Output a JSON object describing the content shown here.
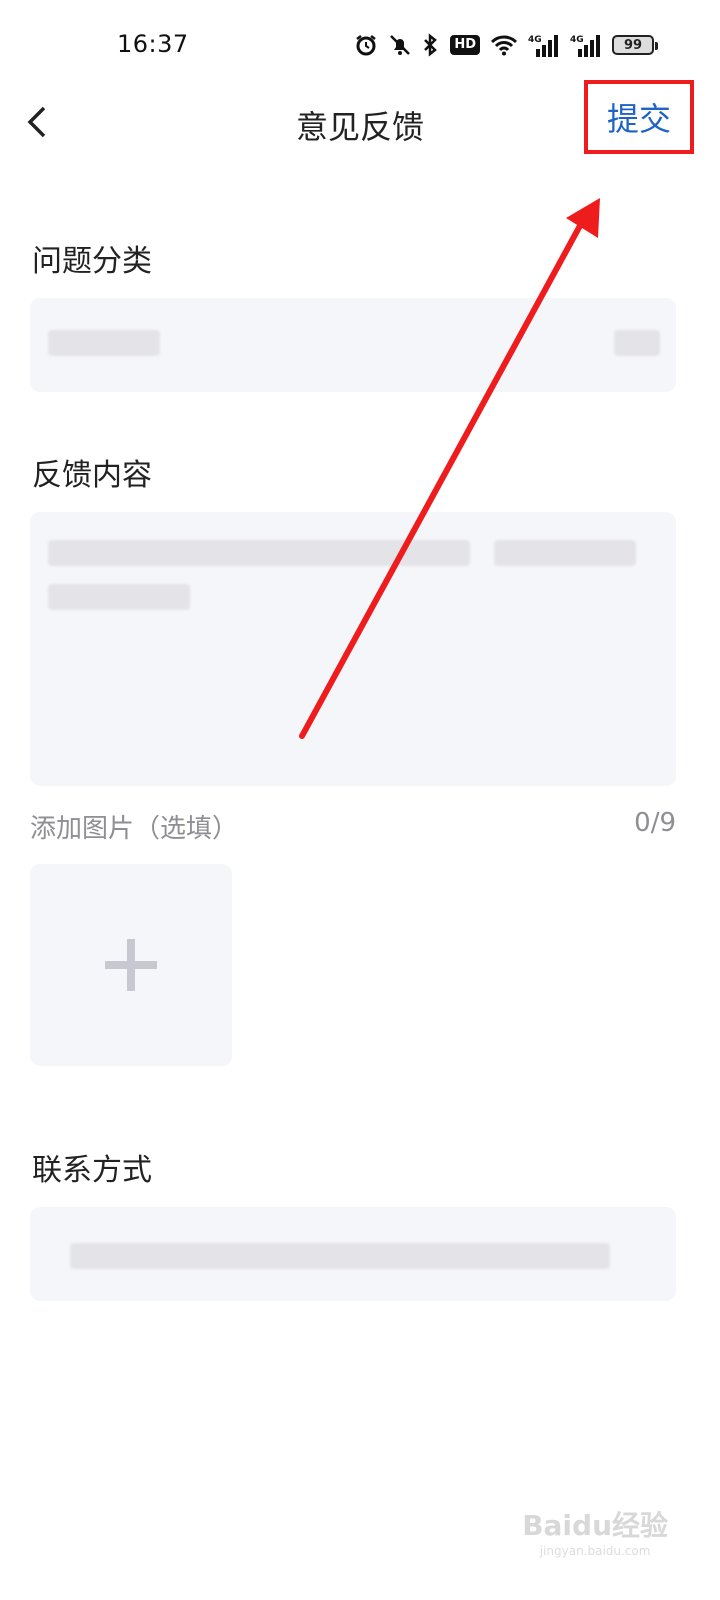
{
  "status_bar": {
    "time": "16:37",
    "icons": [
      "alarm-icon",
      "mute-icon",
      "bluetooth-icon",
      "hd-icon",
      "wifi-icon",
      "signal-4g-icon",
      "signal-4g-icon",
      "battery-icon"
    ],
    "hd_label": "HD",
    "net_label_1": "4G",
    "net_label_2": "4G",
    "battery_level": "99"
  },
  "nav": {
    "title": "意见反馈",
    "submit_label": "提交",
    "submit_color": "#1e63c6",
    "highlight_color": "#ee1c1c"
  },
  "sections": {
    "category_label": "问题分类",
    "content_label": "反馈内容",
    "add_image_label": "添加图片（选填）",
    "image_count": "0/9",
    "contact_label": "联系方式"
  },
  "watermark": {
    "text": "Baidu经验",
    "sub": "jingyan.baidu.com"
  }
}
